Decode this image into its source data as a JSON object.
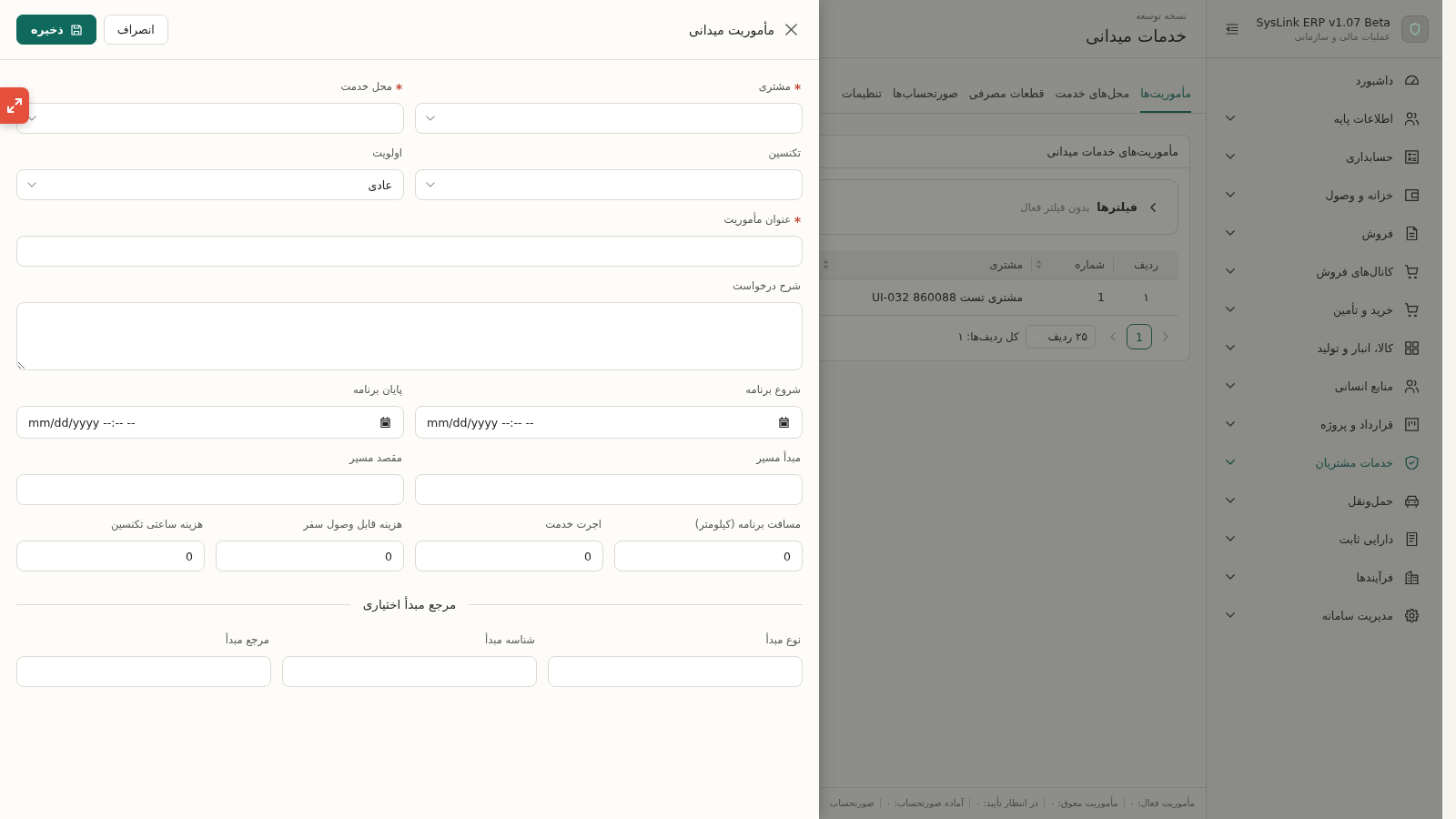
{
  "drawer": {
    "title": "مأموریت میدانی",
    "actions": [
      {
        "label": "انصراف",
        "kind": "secondary"
      },
      {
        "label": "ذخیره",
        "kind": "primary"
      }
    ],
    "rows": [
      [
        {
          "label": "مشتری",
          "required": true,
          "kind": "select"
        },
        {
          "label": "محل خدمت",
          "required": true,
          "kind": "select"
        }
      ],
      [
        {
          "label": "تکنسین",
          "required": false,
          "kind": "select"
        },
        {
          "label": "اولویت",
          "required": false,
          "kind": "select",
          "value": "عادی"
        }
      ],
      [
        {
          "label": "عنوان مأموریت",
          "required": true,
          "kind": "text"
        }
      ],
      [
        {
          "label": "شرح درخواست",
          "required": false,
          "kind": "textarea"
        }
      ],
      [
        {
          "label": "شروع برنامه",
          "required": false,
          "kind": "datetime",
          "placeholder": "mm/dd/yyyy --:-- --"
        },
        {
          "label": "پایان برنامه",
          "required": false,
          "kind": "datetime",
          "placeholder": "mm/dd/yyyy --:-- --"
        }
      ],
      [
        {
          "label": "مبدأ مسیر",
          "required": false,
          "kind": "text"
        },
        {
          "label": "مقصد مسیر",
          "required": false,
          "kind": "text"
        }
      ],
      [
        {
          "label": "مسافت برنامه (کیلومتر)",
          "required": false,
          "kind": "number",
          "value": "0"
        },
        {
          "label": "اجرت خدمت",
          "required": false,
          "kind": "number",
          "value": "0"
        },
        {
          "label": "هزینه قابل وصول سفر",
          "required": false,
          "kind": "number",
          "value": "0"
        },
        {
          "label": "هزینه ساعتی تکنسین",
          "required": false,
          "kind": "number",
          "value": "0"
        }
      ]
    ],
    "optional_section": {
      "title": "مرجع مبدأ اختیاری",
      "fields": [
        {
          "label": "نوع مبدأ",
          "required": false,
          "kind": "text"
        },
        {
          "label": "شناسه مبدأ",
          "required": false,
          "kind": "text"
        },
        {
          "label": "مرجع مبدأ",
          "required": false,
          "kind": "text"
        }
      ]
    }
  },
  "main": {
    "header": {
      "kicker": "نسخه توسعه",
      "title": "خدمات میدانی"
    },
    "tabs": [
      {
        "label": "مأموریت‌ها",
        "selected": true
      },
      {
        "label": "محل‌های خدمت",
        "selected": false
      },
      {
        "label": "قطعات مصرفی",
        "selected": false
      },
      {
        "label": "صورتحساب‌ها",
        "selected": false
      },
      {
        "label": "تنظیمات",
        "selected": false
      }
    ],
    "card": {
      "title": "مأموریت‌های خدمات میدانی",
      "filter": {
        "label": "فیلترها",
        "summary": "بدون فیلتر فعال",
        "expanded": false
      },
      "table": {
        "columns": [
          {
            "label": "ردیف",
            "sortable": false
          },
          {
            "label": "شماره",
            "sortable": true
          },
          {
            "label": "مشتری",
            "sortable": true
          }
        ],
        "rows": [
          [
            "۱",
            "1",
            "مشتری تست 860088 UI-032"
          ]
        ]
      },
      "pagination": {
        "previous": {
          "disabled": true
        },
        "pages": [
          {
            "label": "1",
            "selected": true
          }
        ],
        "next": {
          "disabled": true
        },
        "page_size": "۲۵ ردیف",
        "total": "کل ردیف‌ها: ۱"
      }
    },
    "status_bar": [
      "مأموریت فعال: ۰",
      "مأموریت معوق: ۰",
      "در انتظار تأیید: ۰",
      "آماده صورتحساب: ۰",
      "صورتحساب"
    ]
  },
  "sidebar": {
    "brand": {
      "title": "SysLink ERP v1.07 Beta",
      "subtitle": "عملیات مالی و سازمانی"
    },
    "items": [
      {
        "label": "داشبورد",
        "expandable": false,
        "selected": false
      },
      {
        "label": "اطلاعات پایه",
        "expandable": true,
        "selected": false
      },
      {
        "label": "حسابداری",
        "expandable": true,
        "selected": false
      },
      {
        "label": "خزانه و وصول",
        "expandable": true,
        "selected": false
      },
      {
        "label": "فروش",
        "expandable": true,
        "selected": false
      },
      {
        "label": "کانال‌های فروش",
        "expandable": true,
        "selected": false
      },
      {
        "label": "خرید و تأمین",
        "expandable": true,
        "selected": false
      },
      {
        "label": "کالا، انبار و تولید",
        "expandable": true,
        "selected": false
      },
      {
        "label": "منابع انسانی",
        "expandable": true,
        "selected": false
      },
      {
        "label": "قرارداد و پروژه",
        "expandable": true,
        "selected": false
      },
      {
        "label": "خدمات مشتریان",
        "expandable": true,
        "selected": true
      },
      {
        "label": "حمل‌ونقل",
        "expandable": true,
        "selected": false
      },
      {
        "label": "دارایی ثابت",
        "expandable": true,
        "selected": false
      },
      {
        "label": "فرآیندها",
        "expandable": true,
        "selected": false
      },
      {
        "label": "مدیریت سامانه",
        "expandable": true,
        "selected": false
      }
    ]
  }
}
